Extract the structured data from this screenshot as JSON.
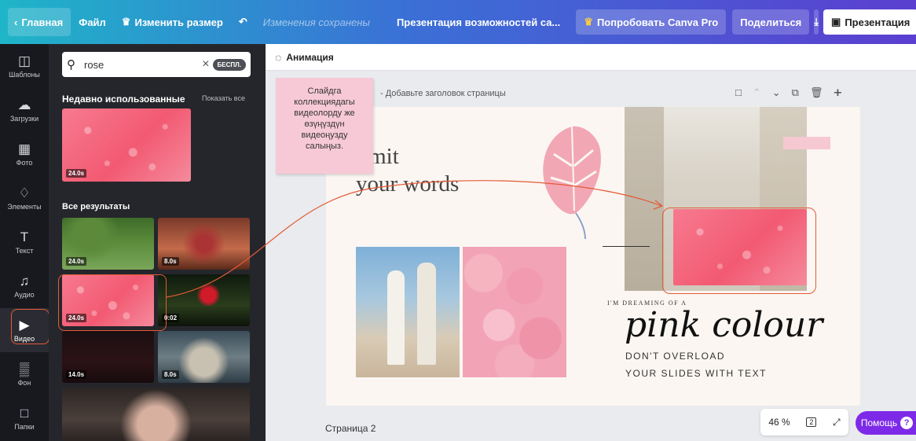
{
  "topbar": {
    "home": "Главная",
    "file": "Файл",
    "resize": "Изменить размер",
    "status": "Изменения сохранены",
    "doc_title": "Презентация возможностей са...",
    "try_pro": "Попробовать Canva Pro",
    "share": "Поделиться",
    "present": "Презентация"
  },
  "sidebar": {
    "items": [
      {
        "label": "Шаблоны",
        "icon": "templates-icon"
      },
      {
        "label": "Загрузки",
        "icon": "upload-cloud-icon"
      },
      {
        "label": "Фото",
        "icon": "photo-icon"
      },
      {
        "label": "Элементы",
        "icon": "elements-icon"
      },
      {
        "label": "Текст",
        "icon": "text-icon"
      },
      {
        "label": "Аудио",
        "icon": "music-icon"
      },
      {
        "label": "Видео",
        "icon": "video-icon"
      },
      {
        "label": "Фон",
        "icon": "background-icon"
      },
      {
        "label": "Папки",
        "icon": "folder-icon"
      }
    ]
  },
  "panel": {
    "search_value": "rose",
    "free_badge": "БЕСПЛ.",
    "recent_heading": "Недавно использованные",
    "see_all": "Показать все",
    "all_heading": "Все результаты",
    "recent": [
      {
        "duration": "24.0s"
      }
    ],
    "results": [
      {
        "duration": "24.0s"
      },
      {
        "duration": "8.0s"
      },
      {
        "duration": "24.0s"
      },
      {
        "duration": "0:02"
      },
      {
        "duration": "14.0s"
      },
      {
        "duration": "8.0s"
      },
      {
        "duration": ""
      }
    ]
  },
  "editor": {
    "animation": "Анимация",
    "page_label": "- Добавьте заголовок страницы",
    "sticky_note": "Слайдга коллекциядагы видеолорду же өзүңүздүн видеоңузду салыңыз.",
    "slide": {
      "headline": "limit\nyour words",
      "dreaming": "I'M DREAMING OF A",
      "pink_colour": "pink colour",
      "dont_overload": "DON'T OVERLOAD",
      "your_slides": "YOUR SLIDES WITH TEXT"
    },
    "page2": "Страница 2",
    "zoom": "46 %",
    "page_count": "2",
    "help": "Помощь"
  },
  "colors": {
    "accent": "#7d2ae8",
    "highlight": "#e35a36"
  }
}
